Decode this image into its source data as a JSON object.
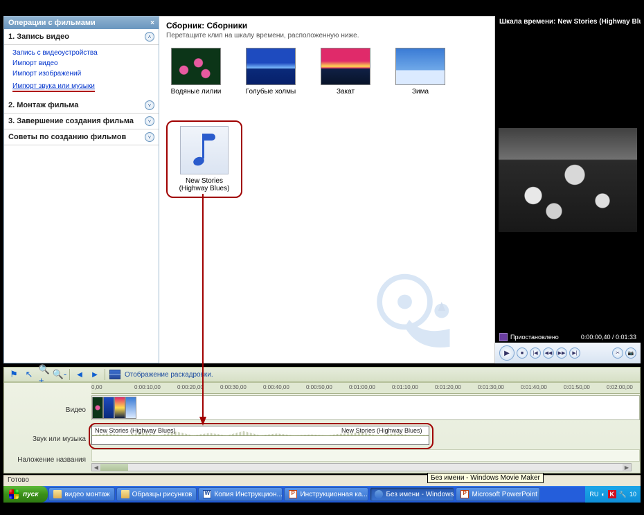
{
  "sidebar": {
    "header": "Операции с фильмами",
    "sections": [
      {
        "title": "1. Запись видео",
        "expanded": true,
        "links": [
          "Запись с видеоустройства",
          "Импорт видео",
          "Импорт изображений",
          "Импорт звука или музыки"
        ]
      },
      {
        "title": "2. Монтаж фильма",
        "expanded": false
      },
      {
        "title": "3. Завершение создания фильма",
        "expanded": false
      },
      {
        "title": "Советы по созданию фильмов",
        "expanded": false
      }
    ]
  },
  "collection": {
    "title": "Сборник: Сборники",
    "subtitle": "Перетащите клип на шкалу времени, расположенную ниже.",
    "thumbs": [
      {
        "label": "Водяные лилии"
      },
      {
        "label": "Голубые холмы"
      },
      {
        "label": "Закат"
      },
      {
        "label": "Зима"
      }
    ],
    "audio_item": "New Stories (Highway Blues)"
  },
  "preview": {
    "title": "Шкала времени: New Stories (Highway Blues)",
    "status": "Приостановлено",
    "time": "0:00:00,40 / 0:01:33"
  },
  "timeline_tools": {
    "storyboard": "Отображение раскадровки."
  },
  "ruler": [
    "0,00",
    "0:00:10,00",
    "0:00:20,00",
    "0:00:30,00",
    "0:00:40,00",
    "0:00:50,00",
    "0:01:00,00",
    "0:01:10,00",
    "0:01:20,00",
    "0:01:30,00",
    "0:01:40,00",
    "0:01:50,00",
    "0:02:00,00"
  ],
  "tracks": {
    "video": "Видео",
    "audio": "Звук или музыка",
    "title": "Наложение названия",
    "audio_clip": "New Stories (Highway Blues)"
  },
  "statusbar": "Готово",
  "tooltip": "Без имени - Windows Movie Maker",
  "taskbar": {
    "start": "пуск",
    "buttons": [
      "видео монтаж",
      "Образцы рисунков",
      "Копия Инструкцион...",
      "Инструкционная ка...",
      "Без имени - Windows...",
      "Microsoft PowerPoint ..."
    ],
    "lang": "RU",
    "time": "10"
  }
}
